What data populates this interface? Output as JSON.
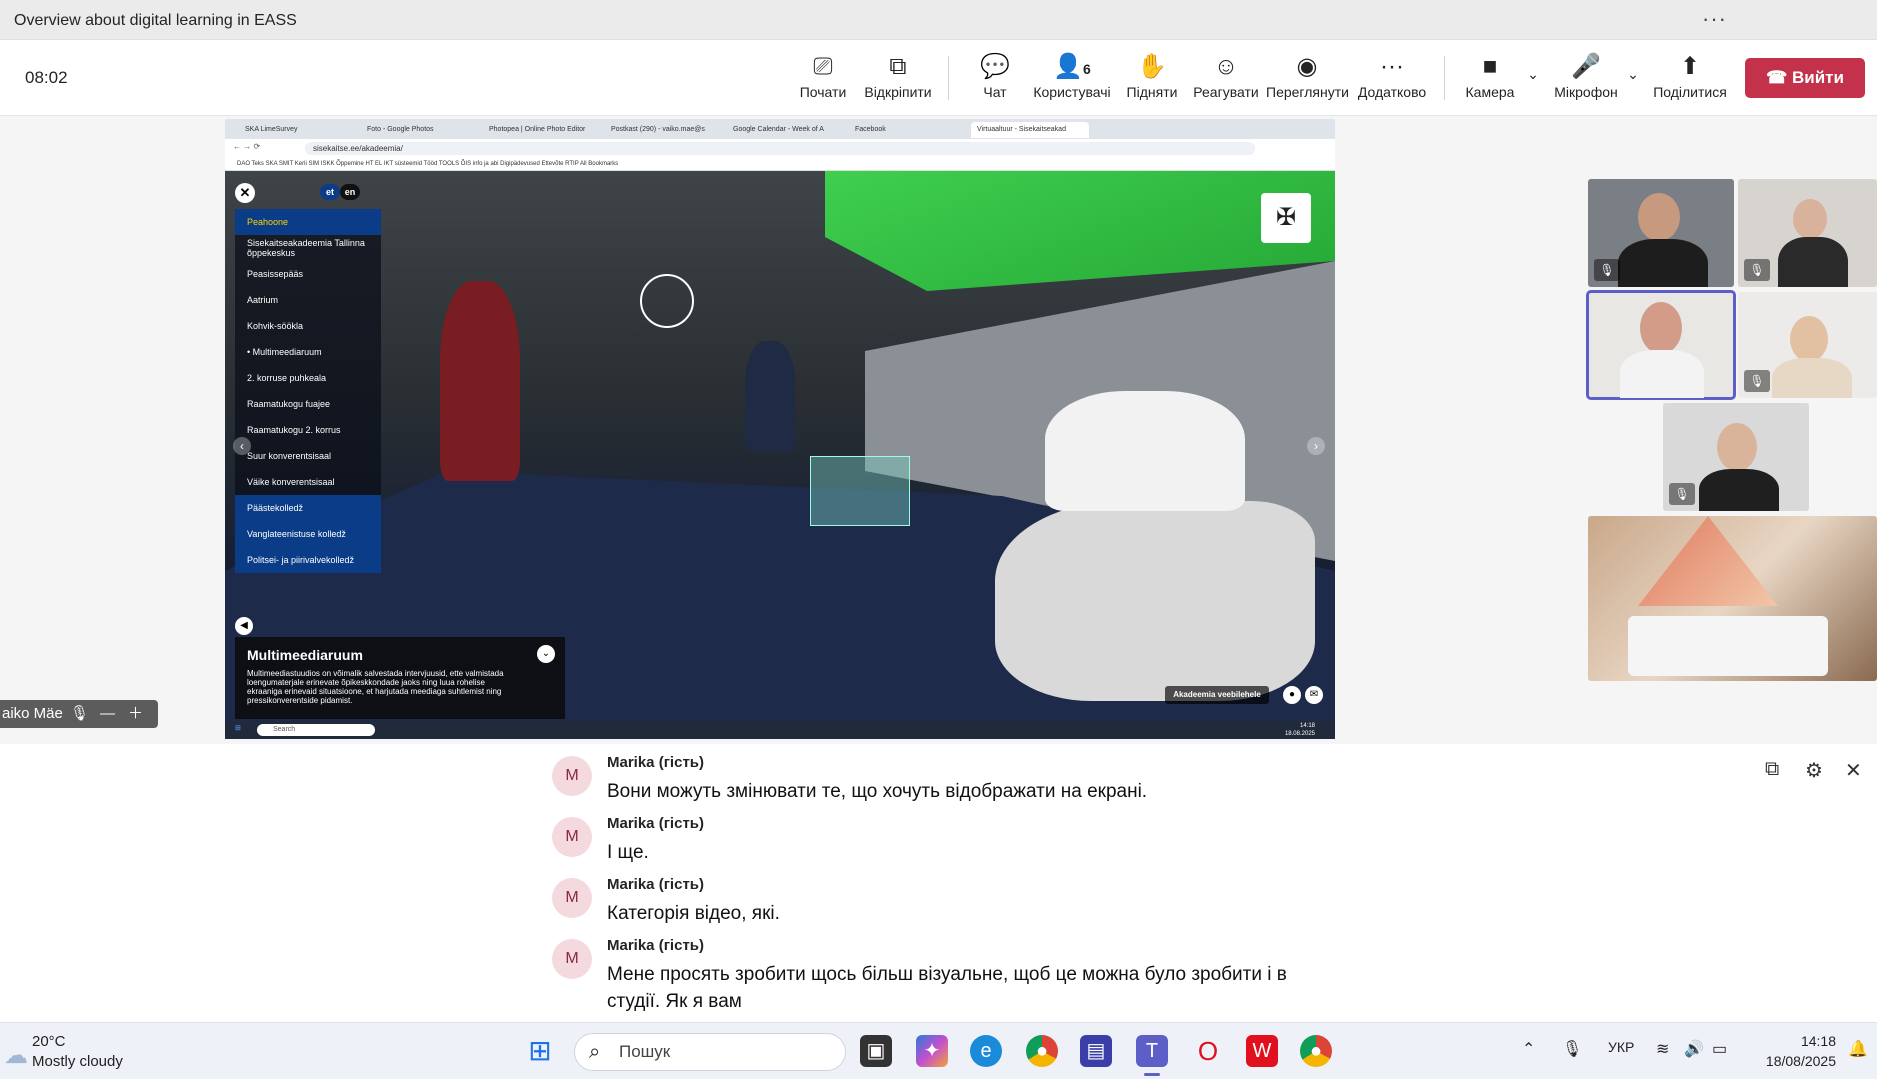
{
  "window": {
    "title": "Overview about digital learning in EASS",
    "more_glyph": "···"
  },
  "meeting": {
    "timer": "08:02",
    "toolbar": [
      {
        "label": "Почати",
        "icon": "screen-share-start-icon",
        "glyph": "⎚"
      },
      {
        "label": "Відкріпити",
        "icon": "pop-out-icon",
        "glyph": "⧉"
      },
      {
        "label": "Чат",
        "icon": "chat-icon",
        "glyph": "💬"
      },
      {
        "label": "Користувачі",
        "icon": "people-icon",
        "glyph": "👤",
        "count": "6"
      },
      {
        "label": "Підняти",
        "icon": "raise-hand-icon",
        "glyph": "✋"
      },
      {
        "label": "Реагувати",
        "icon": "react-icon",
        "glyph": "☺"
      },
      {
        "label": "Переглянути",
        "icon": "view-icon",
        "glyph": "◉"
      },
      {
        "label": "Додатково",
        "icon": "more-icon",
        "glyph": "···"
      },
      {
        "label": "Камера",
        "icon": "camera-icon",
        "glyph": "■"
      },
      {
        "label": "Мікрофон",
        "icon": "microphone-icon",
        "glyph": "🎤"
      },
      {
        "label": "Поділитися",
        "icon": "share-icon",
        "glyph": "⬆"
      }
    ],
    "leave_label": "Вийти",
    "leave_color": "#c4314b",
    "presenter_name": "aiko Mäe"
  },
  "shared_browser": {
    "tabs": [
      "SKA LimeSurvey",
      "Foto - Google Photos",
      "Photopea | Online Photo Editor",
      "Postkast (290) - vaiko.mae@s",
      "Google Calendar - Week of A",
      "Facebook",
      "Virtuaaltuur - Sisekaitseakad"
    ],
    "url": "sisekaitse.ee/akadeemia/",
    "bookmarks": "DAO  Teks  SKA  SMIT  Kerli  SIM  ISKK  Õppemine  HT  EL  IKT süsteemid  Tööd  TOOLS  ÕIS info ja abi  Digipädevused  Ettevõte  RTIP  All Bookmarks",
    "lang": {
      "et": "et",
      "en": "en"
    },
    "menu": [
      {
        "label": "Peahoone",
        "style": "blue-hl"
      },
      {
        "label": "Sisekaitseakadeemia Tallinna õppekeskus",
        "style": ""
      },
      {
        "label": "Peasissepääs",
        "style": ""
      },
      {
        "label": "Aatrium",
        "style": ""
      },
      {
        "label": "Kohvik-söökla",
        "style": ""
      },
      {
        "label": "• Multimeediaruum",
        "style": ""
      },
      {
        "label": "2. korruse puhkeala",
        "style": ""
      },
      {
        "label": "Raamatukogu fuajee",
        "style": ""
      },
      {
        "label": "Raamatukogu 2. korrus",
        "style": ""
      },
      {
        "label": "Suur konverentsisaal",
        "style": ""
      },
      {
        "label": "Väike konverentsisaal",
        "style": ""
      },
      {
        "label": "Päästekolledž",
        "style": "blue"
      },
      {
        "label": "Vanglateenistuse kolledž",
        "style": "blue"
      },
      {
        "label": "Politsei- ja piirivalvekolledž",
        "style": "blue"
      }
    ],
    "info_title": "Multimeediaruum",
    "info_text": "Multimeediastuudios on võimalik salvestada intervjuusid, ette valmistada loengumaterjale erinevate õpikeskkondade jaoks ning luua rohelise ekraaniga erinevaid situatsioone, et harjutada meediaga suhtlemist ning pressikonverentside pidamist.",
    "website_button": "Akadeemia veebilehele",
    "search_placeholder": "Search",
    "clock_time": "14:18",
    "clock_date": "18.08.2025"
  },
  "captions": [
    {
      "initial": "M",
      "speaker": "Marika (гість)",
      "text": "Вони можуть змінювати те, що хочуть відображати на екрані."
    },
    {
      "initial": "M",
      "speaker": "Marika (гість)",
      "text": "І ще."
    },
    {
      "initial": "M",
      "speaker": "Marika (гість)",
      "text": "Категорія відео, які."
    },
    {
      "initial": "M",
      "speaker": "Marika (гість)",
      "text": "Мене просять зробити щось більш візуальне, щоб це можна було зробити і в студії. Як я вам"
    }
  ],
  "taskbar": {
    "temperature": "20°C",
    "weather": "Mostly cloudy",
    "search_placeholder": "Пошук",
    "language": "УКР",
    "time": "14:18",
    "date": "18/08/2025"
  }
}
